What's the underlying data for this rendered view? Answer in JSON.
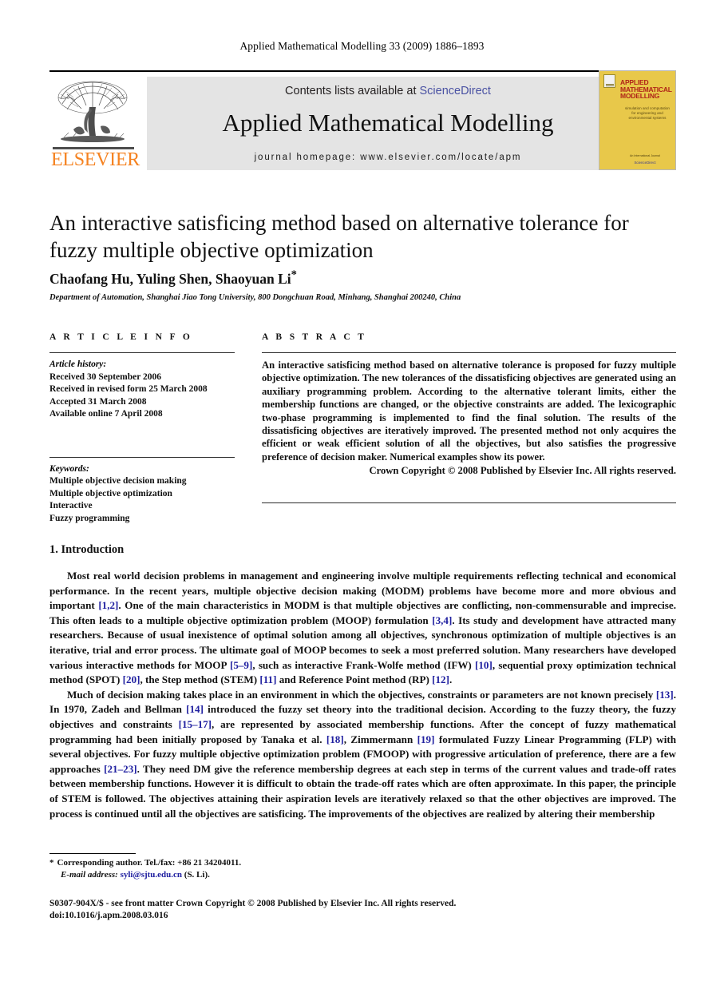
{
  "running_head": "Applied Mathematical Modelling 33 (2009) 1886–1893",
  "masthead": {
    "contents_prefix": "Contents lists available at ",
    "sciencedirect": "ScienceDirect",
    "journal_name": "Applied Mathematical Modelling",
    "homepage": "journal homepage: www.elsevier.com/locate/apm",
    "publisher_wordmark": "ELSEVIER",
    "link_color": "#4a52a3",
    "band_color": "#e4e4e4",
    "wordmark_color": "#f58220"
  },
  "cover": {
    "title": "APPLIED MATHEMATICAL MODELLING",
    "subtitle": "simulation and computation for engineering and environmental systems",
    "footer": "An International Journal",
    "footer_logo": "ScienceDirect",
    "background_color": "#e8c84a",
    "title_color": "#b02418"
  },
  "article": {
    "title": "An interactive satisficing method based on alternative tolerance for fuzzy multiple objective optimization",
    "authors": "Chaofang Hu, Yuling Shen, Shaoyuan Li",
    "author_marker": "*",
    "affiliation": "Department of Automation, Shanghai Jiao Tong University, 800 Dongchuan Road, Minhang, Shanghai 200240, China"
  },
  "info": {
    "heading": "A R T I C L E   I N F O",
    "history_label": "Article history:",
    "history": [
      "Received 30 September 2006",
      "Received in revised form 25 March 2008",
      "Accepted 31 March 2008",
      "Available online 7 April 2008"
    ],
    "keywords_label": "Keywords:",
    "keywords": [
      "Multiple objective decision making",
      "Multiple objective optimization",
      "Interactive",
      "Fuzzy programming"
    ]
  },
  "abstract": {
    "heading": "A B S T R A C T",
    "body": "An interactive satisficing method based on alternative tolerance is proposed for fuzzy multiple objective optimization. The new tolerances of the dissatisficing objectives are generated using an auxiliary programming problem. According to the alternative tolerant limits, either the membership functions are changed, or the objective constraints are added. The lexicographic two-phase programming is implemented to find the final solution. The results of the dissatisficing objectives are iteratively improved. The presented method not only acquires the efficient or weak efficient solution of all the objectives, but also satisfies the progressive preference of decision maker. Numerical examples show its power.",
    "copyright": "Crown Copyright © 2008 Published by Elsevier Inc. All rights reserved."
  },
  "section": {
    "heading": "1. Introduction",
    "paragraph1": {
      "t1": "Most real world decision problems in management and engineering involve multiple requirements reflecting technical and economical performance. In the recent years, multiple objective decision making (MODM) problems have become more and more obvious and important ",
      "r1": "[1,2]",
      "t2": ". One of the main characteristics in MODM is that multiple objectives are conflicting, non-commensurable and imprecise. This often leads to a multiple objective optimization problem (MOOP) formulation ",
      "r2": "[3,4]",
      "t3": ". Its study and development have attracted many researchers. Because of usual inexistence of optimal solution among all objectives, synchronous optimization of multiple objectives is an iterative, trial and error process. The ultimate goal of MOOP becomes to seek a most preferred solution. Many researchers have developed various interactive methods for MOOP ",
      "r3": "[5–9]",
      "t4": ", such as interactive Frank-Wolfe method (IFW) ",
      "r4": "[10]",
      "t5": ", sequential proxy optimization technical method (SPOT) ",
      "r5": "[20]",
      "t6": ", the Step method (STEM) ",
      "r6": "[11]",
      "t7": " and Reference Point method (RP) ",
      "r7": "[12]",
      "t8": "."
    },
    "paragraph2": {
      "t1": "Much of decision making takes place in an environment in which the objectives, constraints or parameters are not known precisely ",
      "r1": "[13]",
      "t2": ". In 1970, Zadeh and Bellman ",
      "r2": "[14]",
      "t3": " introduced the fuzzy set theory into the traditional decision. According to the fuzzy theory, the fuzzy objectives and constraints ",
      "r3": "[15–17]",
      "t4": ", are represented by associated membership functions. After the concept of fuzzy mathematical programming had been initially proposed by Tanaka et al. ",
      "r4": "[18]",
      "t5": ", Zimmermann ",
      "r5": "[19]",
      "t6": " formulated Fuzzy Linear Programming (FLP) with several objectives. For fuzzy multiple objective optimization problem (FMOOP) with progressive articulation of preference, there are a few approaches ",
      "r6": "[21–23]",
      "t7": ". They need DM give the reference membership degrees at each step in terms of the current values and trade-off rates between membership functions. However it is difficult to obtain the trade-off rates which are often approximate. In this paper, the principle of STEM is followed. The objectives attaining their aspiration levels are iteratively relaxed so that the other objectives are improved. The process is continued until all the objectives are satisficing. The improvements of the objectives are realized by altering their membership"
    }
  },
  "footnote": {
    "star": "*",
    "corresponding": "Corresponding author. Tel./fax: +86 21 34204011.",
    "email_label": "E-mail address:",
    "email": "syli@sjtu.edu.cn",
    "email_suffix": "(S. Li).",
    "link_color": "#2020a0"
  },
  "footer": {
    "issn_line": "S0307-904X/$ - see front matter Crown Copyright © 2008 Published by Elsevier Inc. All rights reserved.",
    "doi_line": "doi:10.1016/j.apm.2008.03.016"
  }
}
